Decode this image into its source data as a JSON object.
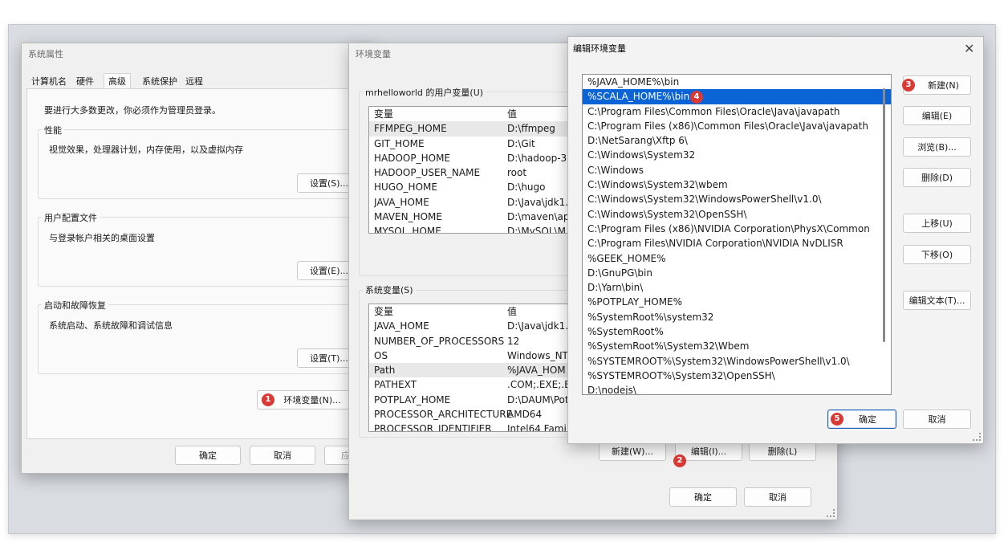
{
  "sysprops": {
    "title": "系统属性",
    "tabs": [
      "计算机名",
      "硬件",
      "高级",
      "系统保护",
      "远程"
    ],
    "admin_note": "要进行大多数更改，你必须作为管理员登录。",
    "perf": {
      "heading": "性能",
      "desc": "视觉效果，处理器计划，内存使用，以及虚拟内存",
      "button": "设置(S)..."
    },
    "profile": {
      "heading": "用户配置文件",
      "desc": "与登录帐户相关的桌面设置",
      "button": "设置(E)..."
    },
    "startup": {
      "heading": "启动和故障恢复",
      "desc": "系统启动、系统故障和调试信息",
      "button": "设置(T)..."
    },
    "envvars_button": "环境变量(N)...",
    "ok": "确定",
    "cancel": "取消",
    "apply": "应"
  },
  "envvars": {
    "title": "环境变量",
    "user_group": "mrhelloworld 的用户变量(U)",
    "system_group": "系统变量(S)",
    "col_var": "变量",
    "col_val": "值",
    "user_rows": [
      {
        "name": "FFMPEG_HOME",
        "value": "D:\\ffmpeg"
      },
      {
        "name": "GIT_HOME",
        "value": "D:\\Git"
      },
      {
        "name": "HADOOP_HOME",
        "value": "D:\\hadoop-3."
      },
      {
        "name": "HADOOP_USER_NAME",
        "value": "root"
      },
      {
        "name": "HUGO_HOME",
        "value": "D:\\hugo"
      },
      {
        "name": "JAVA_HOME",
        "value": "D:\\Java\\jdk1.8"
      },
      {
        "name": "MAVEN_HOME",
        "value": "D:\\maven\\apa"
      },
      {
        "name": "MYSQL_HOME",
        "value": "D:\\MySQL\\M"
      }
    ],
    "system_rows": [
      {
        "name": "JAVA_HOME",
        "value": "D:\\Java\\jdk1.8"
      },
      {
        "name": "NUMBER_OF_PROCESSORS",
        "value": "12"
      },
      {
        "name": "OS",
        "value": "Windows_NT"
      },
      {
        "name": "Path",
        "value": "%JAVA_HOM"
      },
      {
        "name": "PATHEXT",
        "value": ".COM;.EXE;.BA"
      },
      {
        "name": "POTPLAY_HOME",
        "value": "D:\\DAUM\\Pot"
      },
      {
        "name": "PROCESSOR_ARCHITECTURE",
        "value": "AMD64"
      },
      {
        "name": "PROCESSOR_IDENTIFIER",
        "value": "Intel64 Fami"
      }
    ],
    "new_button": "新建(W)...",
    "edit_button": "编辑(I)...",
    "delete_button": "删除(L)",
    "ok": "确定",
    "cancel": "取消"
  },
  "editor": {
    "title": "编辑环境变量",
    "entries": [
      "%JAVA_HOME%\\bin",
      "%SCALA_HOME%\\bin",
      "C:\\Program Files\\Common Files\\Oracle\\Java\\javapath",
      "C:\\Program Files (x86)\\Common Files\\Oracle\\Java\\javapath",
      "D:\\NetSarang\\Xftp 6\\",
      "C:\\Windows\\System32",
      "C:\\Windows",
      "C:\\Windows\\System32\\wbem",
      "C:\\Windows\\System32\\WindowsPowerShell\\v1.0\\",
      "C:\\Windows\\System32\\OpenSSH\\",
      "C:\\Program Files (x86)\\NVIDIA Corporation\\PhysX\\Common",
      "C:\\Program Files\\NVIDIA Corporation\\NVIDIA NvDLISR",
      "%GEEK_HOME%",
      "D:\\GnuPG\\bin",
      "D:\\Yarn\\bin\\",
      "%POTPLAY_HOME%",
      "%SystemRoot%\\system32",
      "%SystemRoot%",
      "%SystemRoot%\\System32\\Wbem",
      "%SYSTEMROOT%\\System32\\WindowsPowerShell\\v1.0\\",
      "%SYSTEMROOT%\\System32\\OpenSSH\\",
      "D:\\nodejs\\"
    ],
    "selected_index": 1,
    "new_button": "新建(N)",
    "edit_button": "编辑(E)",
    "browse_button": "浏览(B)...",
    "delete_button": "删除(D)",
    "up_button": "上移(U)",
    "down_button": "下移(O)",
    "edit_text_button": "编辑文本(T)...",
    "ok": "确定",
    "cancel": "取消",
    "close_glyph": "✕"
  },
  "badges": {
    "b1": "1",
    "b2": "2",
    "b3": "3",
    "b4": "4",
    "b5": "5"
  },
  "colors": {
    "selection": "#0a64d6",
    "badge": "#d93a36",
    "primary_border": "#1a5fb4"
  }
}
